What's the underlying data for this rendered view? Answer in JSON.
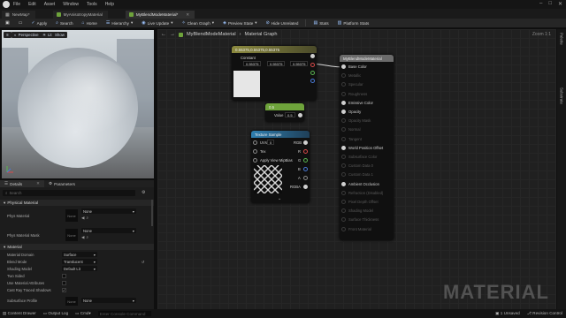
{
  "menubar": {
    "items": [
      "File",
      "Edit",
      "Asset",
      "Window",
      "Tools",
      "Help"
    ]
  },
  "tabs": [
    {
      "label": "NewMap*"
    },
    {
      "label": "MyAnisotropyMaterial"
    },
    {
      "label": "MyBlendModeMaterial*"
    }
  ],
  "toolbar": {
    "save": "",
    "apply": "Apply",
    "search": "Search",
    "home": "Home",
    "hierarchy": "Hierarchy",
    "live_update": "Live Update",
    "clean_graph": "Clean Graph",
    "preview_state": "Preview State",
    "hide_unrelated": "Hide Unrelated",
    "stats": "Stats",
    "platform_stats": "Platform Stats"
  },
  "viewport": {
    "perspective": "Perspective",
    "lit": "Lit",
    "show": "Show"
  },
  "details": {
    "tab_details": "Details",
    "tab_parameters": "Parameters",
    "search_placeholder": "Search",
    "section_physical": "Physical Material",
    "phys_material": "Phys Material",
    "phys_material_value": "None",
    "phys_material_mask": "Phys Material Mask",
    "phys_material_mask_value": "None",
    "thumb_none": "None",
    "section_material": "Material",
    "material_domain": "Material Domain",
    "material_domain_value": "Surface",
    "blend_mode": "Blend Mode",
    "blend_mode_value": "Translucent",
    "shading_model": "Shading Model",
    "shading_model_value": "Default Lit",
    "two_sided": "Two Sided",
    "use_material_attributes": "Use Material Attributes",
    "cast_ray_traced_shadows": "Cast Ray Traced Shadows",
    "subsurface_profile": "Subsurface Profile",
    "subsurface_profile_value": "None"
  },
  "graph": {
    "breadcrumb_material": "MyBlendModeMaterial",
    "breadcrumb_graph": "Material Graph",
    "zoom": "Zoom 1:1",
    "watermark": "MATERIAL",
    "constant_node": {
      "header": "0.55375,0.55375,0.55375",
      "label": "Constant",
      "r": "0.55375",
      "g": "0.55375",
      "b": "0.55375"
    },
    "scalar_node": {
      "header": "0.5",
      "label": "Value",
      "value": "0.5"
    },
    "texture_node": {
      "header": "Texture Sample",
      "uvs": "UVs",
      "uvs_value": "0",
      "tex": "Tex",
      "apply_mips": "Apply View MipBias",
      "out_rgb": "RGB",
      "out_r": "R",
      "out_g": "G",
      "out_b": "B",
      "out_a": "A",
      "out_rgba": "RGBA"
    },
    "material_node": {
      "header": "MyBlendModeMaterial",
      "pins": [
        {
          "label": "Base Color",
          "active": true
        },
        {
          "label": "Metallic",
          "active": false
        },
        {
          "label": "Specular",
          "active": false
        },
        {
          "label": "Roughness",
          "active": false
        },
        {
          "label": "Emissive Color",
          "active": true
        },
        {
          "label": "Opacity",
          "active": true
        },
        {
          "label": "Opacity Mask",
          "active": false
        },
        {
          "label": "Normal",
          "active": false
        },
        {
          "label": "Tangent",
          "active": false
        },
        {
          "label": "World Position Offset",
          "active": true
        },
        {
          "label": "Subsurface Color",
          "active": false
        },
        {
          "label": "Custom Data 0",
          "active": false
        },
        {
          "label": "Custom Data 1",
          "active": false
        },
        {
          "label": "Ambient Occlusion",
          "active": true
        },
        {
          "label": "Refraction (Disabled)",
          "active": false
        },
        {
          "label": "Pixel Depth Offset",
          "active": false
        },
        {
          "label": "Shading Model",
          "active": false
        },
        {
          "label": "Surface Thickness",
          "active": false
        },
        {
          "label": "Front Material",
          "active": false
        }
      ]
    }
  },
  "sidetabs": {
    "palette": "Palette",
    "substrate": "Substrate"
  },
  "statusbar": {
    "content_drawer": "Content Drawer",
    "output_log": "Output Log",
    "cmd": "Cmd",
    "cmd_placeholder": "Enter Console Command",
    "unsaved": "1 Unsaved",
    "revision": "Revision Control"
  },
  "colors": {
    "green_header": "#6ea33b",
    "constant_header": "#8c8a3f",
    "texture_header": "#2f7fb0",
    "material_header": "#6b6b6b"
  }
}
